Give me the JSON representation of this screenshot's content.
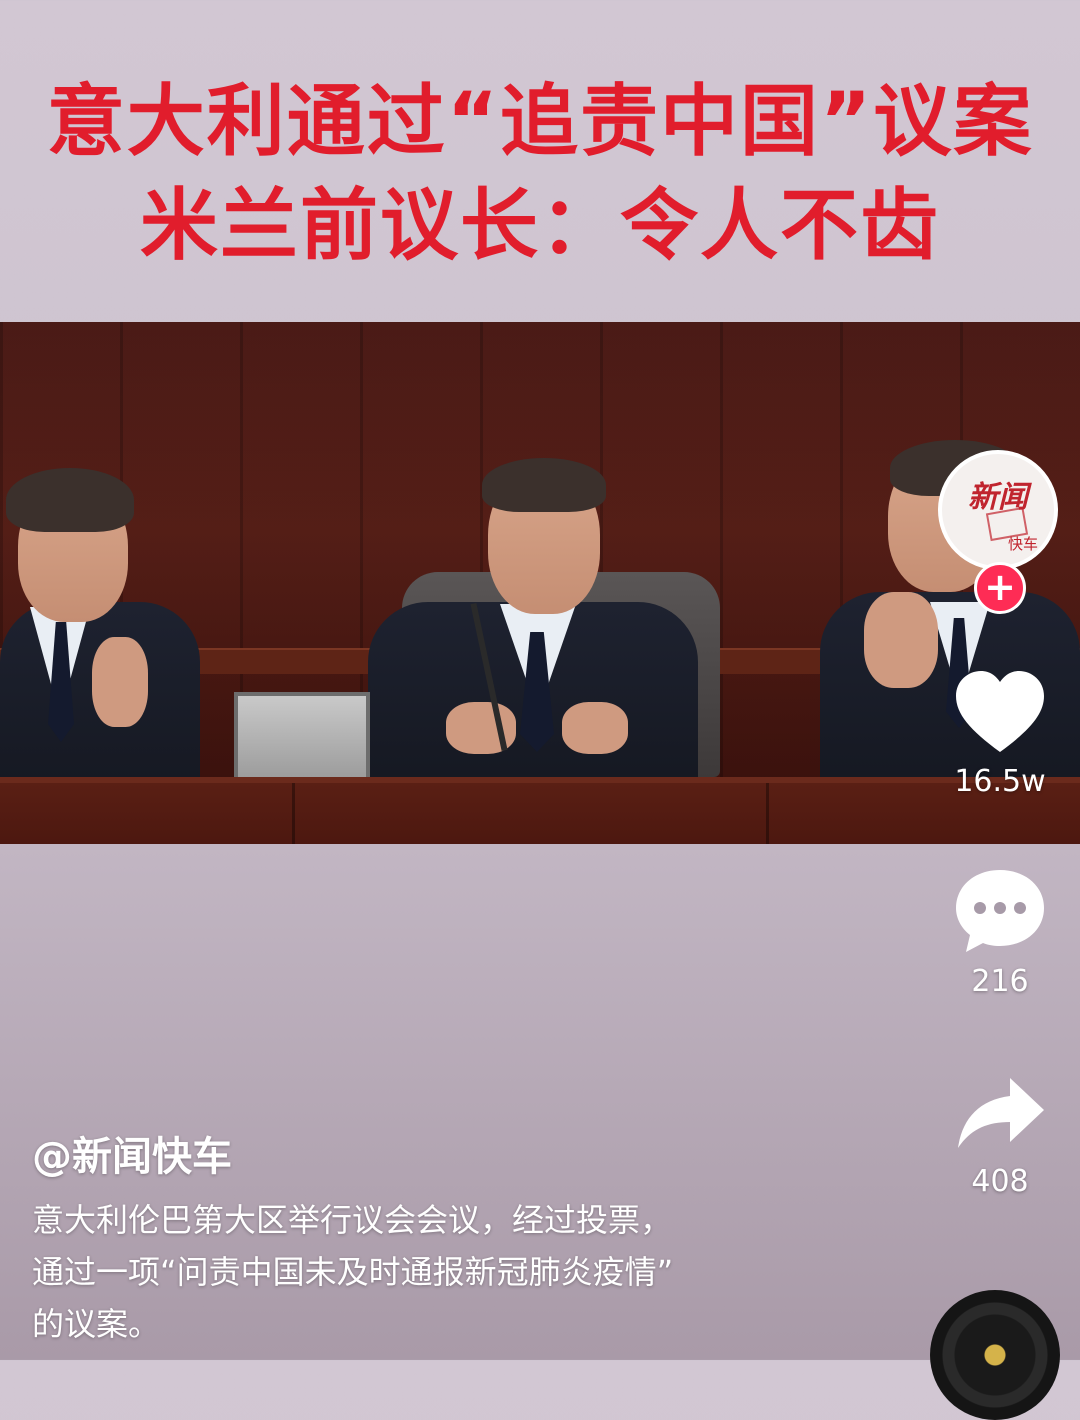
{
  "headline": {
    "line1": "意大利通过“追责中国”议案",
    "line2": "米兰前议长：令人不齿"
  },
  "video": {
    "scene": "Council session with three men seated behind a wooden bench"
  },
  "account": {
    "avatar_mark": "新闻",
    "avatar_sub": "快车",
    "follow_symbol": "+",
    "handle": "@新闻快车"
  },
  "actions": {
    "likes": "16.5w",
    "comments": "216",
    "shares": "408"
  },
  "caption": {
    "line1": "意大利伦巴第大区举行议会会议，经过投票，",
    "line2": "通过一项“问责中国未及时通报新冠肺炎疫情”",
    "line3": "的议案。"
  },
  "colors": {
    "headline": "#e11d2c",
    "follow": "#fe2c55",
    "icon": "#ffffff"
  },
  "icons": {
    "like": "heart-icon",
    "comment": "comment-bubble-icon",
    "share": "share-arrow-icon",
    "music": "music-disc-icon"
  }
}
